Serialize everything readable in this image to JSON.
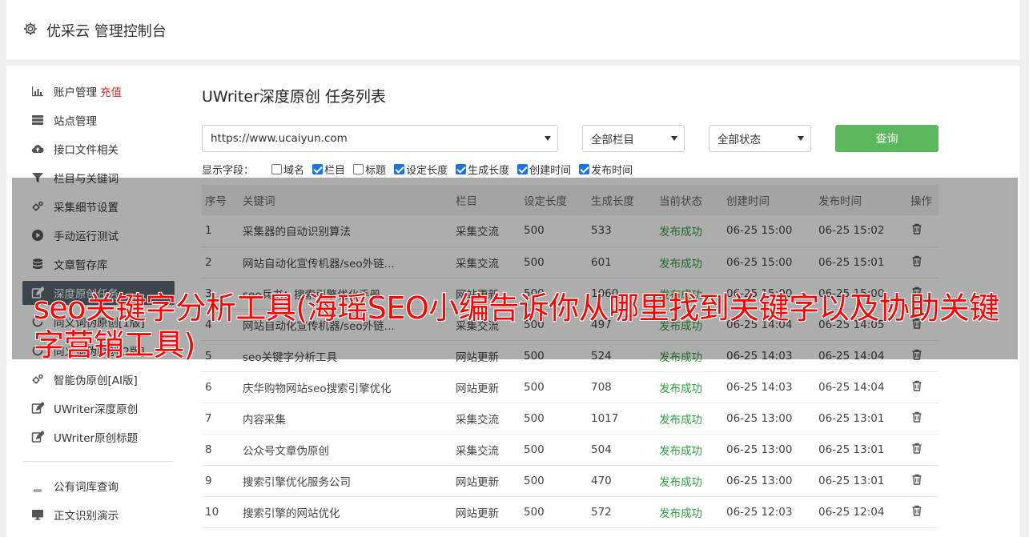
{
  "header": {
    "title": "优采云 管理控制台"
  },
  "sidebar": {
    "items": [
      {
        "label": "账户管理",
        "badge": "充值",
        "icon": "bar-chart-icon"
      },
      {
        "label": "站点管理",
        "icon": "server-icon"
      },
      {
        "label": "接口文件相关",
        "icon": "cloud-upload-icon"
      },
      {
        "label": "栏目与关键词",
        "icon": "filter-icon"
      },
      {
        "label": "采集细节设置",
        "icon": "gears-icon"
      },
      {
        "label": "手动运行测试",
        "icon": "play-icon"
      },
      {
        "label": "文章暂存库",
        "icon": "database-icon"
      },
      {
        "label": "深度原创任务",
        "icon": "edit-icon",
        "active": true
      },
      {
        "label": "同义词伪原创[1版]",
        "icon": "refresh-icon"
      },
      {
        "label": "同义词伪原创[2版]",
        "icon": "refresh-icon"
      },
      {
        "label": "智能伪原创[AI版]",
        "icon": "gears-icon"
      },
      {
        "label": "UWriter深度原创",
        "icon": "edit-icon"
      },
      {
        "label": "UWriter原创标题",
        "icon": "edit-icon"
      }
    ],
    "items2": [
      {
        "label": "公有词库查询",
        "icon": "book-icon"
      },
      {
        "label": "正文识别演示",
        "icon": "monitor-icon"
      }
    ]
  },
  "main": {
    "title": "UWriter深度原创 任务列表",
    "site_select": "https://www.ucaiyun.com",
    "column_select": "全部栏目",
    "status_select": "全部状态",
    "query_label": "查询",
    "fields_label": "显示字段：",
    "fields": [
      {
        "label": "域名",
        "checked": false
      },
      {
        "label": "栏目",
        "checked": true
      },
      {
        "label": "标题",
        "checked": false
      },
      {
        "label": "设定长度",
        "checked": true
      },
      {
        "label": "生成长度",
        "checked": true
      },
      {
        "label": "创建时间",
        "checked": true
      },
      {
        "label": "发布时间",
        "checked": true
      }
    ],
    "columns": [
      "序号",
      "关键词",
      "栏目",
      "设定长度",
      "生成长度",
      "当前状态",
      "创建时间",
      "发布时间",
      "操作"
    ],
    "rows": [
      [
        "1",
        "采集器的自动识别算法",
        "采集交流",
        "500",
        "533",
        "发布成功",
        "06-25 15:00",
        "06-25 15:02"
      ],
      [
        "2",
        "网站自动化宣传机器/seo外链...",
        "采集交流",
        "500",
        "601",
        "发布成功",
        "06-25 15:00",
        "06-25 15:01"
      ],
      [
        "3",
        "seo兵书：搜索引擎优化手册",
        "网站更新",
        "500",
        "1060",
        "发布成功",
        "06-25 15:00",
        "06-25 15:00"
      ],
      [
        "4",
        "网站自动化宣传机器/seo外链...",
        "采集交流",
        "500",
        "497",
        "发布成功",
        "06-25 14:04",
        "06-25 14:05"
      ],
      [
        "5",
        "seo关键字分析工具",
        "网站更新",
        "500",
        "524",
        "发布成功",
        "06-25 14:03",
        "06-25 14:04"
      ],
      [
        "6",
        "庆华购物网站seo搜索引擎优化",
        "网站更新",
        "500",
        "708",
        "发布成功",
        "06-25 14:03",
        "06-25 14:04"
      ],
      [
        "7",
        "内容采集",
        "采集交流",
        "500",
        "1017",
        "发布成功",
        "06-25 13:00",
        "06-25 13:01"
      ],
      [
        "8",
        "公众号文章伪原创",
        "采集交流",
        "500",
        "504",
        "发布成功",
        "06-25 13:00",
        "06-25 13:01"
      ],
      [
        "9",
        "搜索引擎优化服务公司",
        "网站更新",
        "500",
        "470",
        "发布成功",
        "06-25 13:00",
        "06-25 13:01"
      ],
      [
        "10",
        "搜索引擎的网站优化",
        "网站更新",
        "500",
        "572",
        "发布成功",
        "06-25 12:03",
        "06-25 12:04"
      ]
    ]
  },
  "caption": "seo关键字分析工具(海瑶SEO小编告诉你从哪里找到关键字以及协助关键字营销工具)"
}
